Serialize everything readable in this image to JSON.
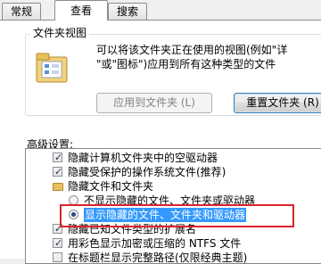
{
  "tabs": [
    "常规",
    "查看",
    "搜索"
  ],
  "active_tab": "查看",
  "folder_views": {
    "title": "文件夹视图",
    "description_line1": "可以将该文件夹正在使用的视图(例如\"详",
    "description_line2": "\"或\"图标\")应用到所有这种类型的文件",
    "apply_button": "应用到文件夹 (L)",
    "reset_button": "重置文件夹 (R)"
  },
  "advanced": {
    "label": "高级设置:",
    "items": [
      {
        "type": "checkbox",
        "checked": true,
        "text": "隐藏计算机文件夹中的空驱动器"
      },
      {
        "type": "checkbox",
        "checked": true,
        "text": "隐藏受保护的操作系统文件(推荐)"
      },
      {
        "type": "folder",
        "text": "隐藏文件和文件夹"
      },
      {
        "type": "radio",
        "selected": false,
        "text": "不显示隐藏的文件、文件夹或驱动器"
      },
      {
        "type": "radio",
        "selected": true,
        "text": "显示隐藏的文件、文件夹和驱动器"
      },
      {
        "type": "checkbox",
        "checked": true,
        "text": "隐藏已知文件类型的扩展名"
      },
      {
        "type": "checkbox",
        "checked": true,
        "text": "用彩色显示加密或压缩的 NTFS 文件"
      },
      {
        "type": "checkbox",
        "checked": false,
        "text": "在标题栏显示完整路径(仅限经典主题)"
      }
    ]
  }
}
